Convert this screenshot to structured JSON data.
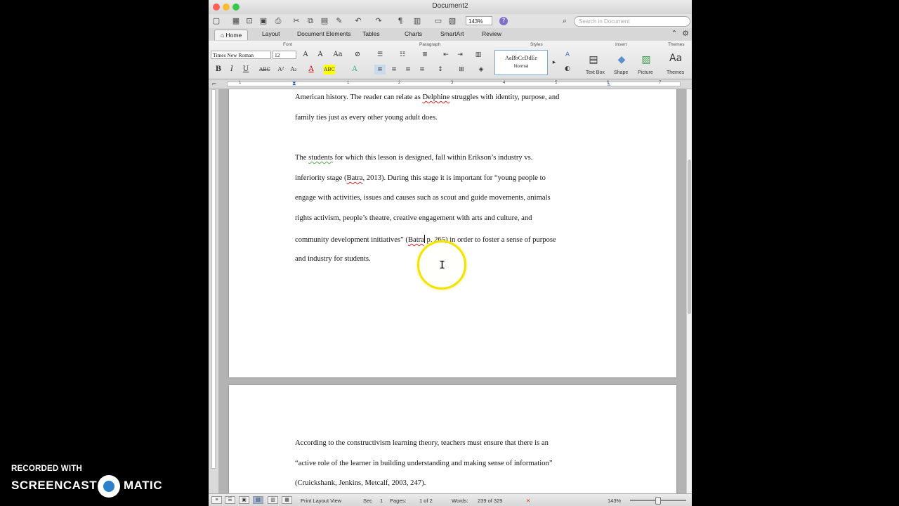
{
  "window": {
    "title": "Document2"
  },
  "toolbar": {
    "zoom": "143%",
    "search_placeholder": "Search in Document"
  },
  "tabs": [
    "Home",
    "Layout",
    "Document Elements",
    "Tables",
    "Charts",
    "SmartArt",
    "Review"
  ],
  "ribbon": {
    "groups": {
      "font": "Font",
      "paragraph": "Paragraph",
      "styles": "Styles",
      "insert": "Insert",
      "themes": "Themes"
    },
    "font_name": "Times New Roman",
    "font_size": "12",
    "style_preview": "AaBbCcDdEe",
    "style_name": "Normal",
    "insert_items": [
      "Text Box",
      "Shape",
      "Picture"
    ],
    "themes_label": "Themes"
  },
  "ruler": {
    "numbers": [
      "1",
      "1",
      "2",
      "3",
      "4",
      "5",
      "6",
      "7"
    ]
  },
  "page1": {
    "lines": [
      {
        "a": "American history.  The reader can relate as ",
        "s": "Delphine",
        "b": " struggles with identity, purpose, and"
      },
      {
        "a": "family ties just as every other young adult does.",
        "s": "",
        "b": ""
      },
      {
        "a": "The ",
        "g": "students",
        "b": " for which this lesson is designed, fall within Erikson’s industry vs."
      },
      {
        "a": "inferiority stage (",
        "s": "Batra",
        "b": ", 2013).  During this stage it is important for “young people to"
      },
      {
        "a": "engage with activities, issues and causes such as scout and guide movements, animals",
        "s": "",
        "b": ""
      },
      {
        "a": "rights activism, people’s theatre, creative engagement with arts and culture, and",
        "s": "",
        "b": ""
      },
      {
        "a": "community development initiatives” (",
        "s": "Batra",
        "b": " p. 265) in order to foster a sense of purpose"
      },
      {
        "a": "and industry for students.",
        "s": "",
        "b": ""
      }
    ]
  },
  "page2": {
    "lines": [
      "According to the constructivism learning theory, teachers must ensure that there is an",
      "“active role of the learner in building understanding and making sense of information”",
      "(Cruickshank, Jenkins, Metcalf, 2003, 247)."
    ]
  },
  "status": {
    "view": "Print Layout View",
    "sec_label": "Sec",
    "sec": "1",
    "pages_label": "Pages:",
    "pages": "1 of 2",
    "words_label": "Words:",
    "words": "239 of 329",
    "zoom": "143%"
  },
  "watermark": {
    "line1": "RECORDED WITH",
    "left": "SCREENCAST",
    "right": "MATIC"
  },
  "colors": {
    "highlight": "#f2e400",
    "brand": "#2c7fc9"
  }
}
